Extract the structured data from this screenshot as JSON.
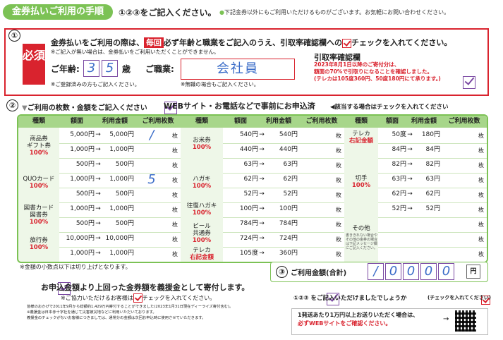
{
  "header": {
    "title": "金券払いご利用の手順",
    "instruction": "①②③をご記入ください。",
    "note": "下記金券以外にもご利用いただけるものがございます。お気軽にお問い合わせください。"
  },
  "section1": {
    "number": "①",
    "must": "必須",
    "line1_a": "金券払いをご利用の際は、",
    "line1_every": "毎回",
    "line1_b": "必ず年齢と職業をご記入のうえ、引取率確認欄への",
    "line1_c": "チェックを入れてください。",
    "line2": "※ご記入が無い場合は、金券払いをご利用いただくことができません。",
    "age_label": "ご年齢:",
    "age_digits": [
      "3",
      "5"
    ],
    "age_unit": "歳",
    "job_label": "ご職業:",
    "job_value": "会社員",
    "note_registered": "※ご登録済みの方もご記入ください。",
    "note_unemployed": "※無職の場合もご記入ください。",
    "rate_title": "引取率確認欄",
    "rate_1": "2023年8月1日以降のご寄付分は、",
    "rate_2": "額面の70%で引取りになることを確認しました。",
    "rate_3": "(テレカは105度360円、50度180円にて承ります。)"
  },
  "section2": {
    "number": "②",
    "title": "ご利用の枚数・金額をご記入ください",
    "web_label": "WEBサイト・お電話などで事前にお申込済",
    "web_note": "◀該当する場合はチェックを入れてください",
    "headers": {
      "kind": "種類",
      "face": "額面",
      "amount": "利用金額",
      "count": "ご利用枚数"
    },
    "unit": "枚",
    "col1": {
      "rows": [
        {
          "face": "5,000円",
          "amount": "5,000円",
          "count": "/"
        },
        {
          "face": "1,000円",
          "amount": "1,000円",
          "count": ""
        },
        {
          "face": "500円",
          "amount": "500円",
          "count": ""
        },
        {
          "face": "1,000円",
          "amount": "1,000円",
          "count": "5"
        },
        {
          "face": "500円",
          "amount": "500円",
          "count": ""
        },
        {
          "face": "1,000円",
          "amount": "1,000円",
          "count": ""
        },
        {
          "face": "500円",
          "amount": "500円",
          "count": ""
        },
        {
          "face": "10,000円",
          "amount": "10,000円",
          "count": ""
        },
        {
          "face": "1,000円",
          "amount": "1,000円",
          "count": ""
        }
      ],
      "categories": [
        {
          "name": "商品券\nギフト券",
          "pct": "100%"
        },
        {
          "name": "QUOカード",
          "pct": "100%"
        },
        {
          "name": "図書カード\n図書券",
          "pct": "100%"
        },
        {
          "name": "旅行券",
          "pct": "100%"
        }
      ]
    },
    "col2": {
      "rows": [
        {
          "face": "540円",
          "amount": "540円"
        },
        {
          "face": "440円",
          "amount": "440円"
        },
        {
          "face": "63円",
          "amount": "63円"
        },
        {
          "face": "62円",
          "amount": "62円"
        },
        {
          "face": "52円",
          "amount": "52円"
        },
        {
          "face": "100円",
          "amount": "100円"
        },
        {
          "face": "784円",
          "amount": "784円"
        },
        {
          "face": "724円",
          "amount": "724円"
        },
        {
          "face": "105度",
          "amount": "360円"
        }
      ],
      "categories": [
        {
          "name": "お米券",
          "pct": "100%"
        },
        {
          "name": "ハガキ",
          "pct": "100%"
        },
        {
          "name": "往復ハガキ",
          "pct": "100%"
        },
        {
          "name": "ビール\n共通券",
          "pct": "100%"
        },
        {
          "name": "テレカ",
          "pct": "右記金額"
        }
      ]
    },
    "col3": {
      "rows": [
        {
          "face": "50度",
          "amount": "180円"
        },
        {
          "face": "84円",
          "amount": "84円"
        },
        {
          "face": "82円",
          "amount": "82円"
        },
        {
          "face": "63円",
          "amount": "63円"
        },
        {
          "face": "62円",
          "amount": "62円"
        },
        {
          "face": "52円",
          "amount": "52円"
        }
      ],
      "categories": [
        {
          "name": "テレカ",
          "pct": "右記金額"
        },
        {
          "name": "切手",
          "pct": "100%"
        },
        {
          "name": "その他",
          "pct": ""
        }
      ],
      "other_note": "書ききれない場合やその他の金券の場合は下記メッセージ欄にご記入ください。"
    }
  },
  "footnote": "※金額の小数点以下は切り上げとなります。",
  "section3": {
    "number": "③",
    "label": "ご利用金額(合計)",
    "digits": [
      "/",
      "0",
      "0",
      "0",
      "0"
    ],
    "unit": "円"
  },
  "donation": {
    "title": "お申込金額より上回った金券額を義援金として寄付します。",
    "sub_a": "※ご協力いただけるお客様は",
    "sub_b": "チェックを入れてください。",
    "fine1": "皆様のおかげで2011年9月から総額約1,429万円寄付することができました(2023年1月31日現在ディーライズ寄付含む)。",
    "fine2": "※義援金は日本赤十字社を通じて災害被災地などに利用いただいております。",
    "fine3": "義援金のチェックがないお客様につきましては、通常分の金額は次回お申込時に使用させていただきます。"
  },
  "confirm": {
    "text": "①②③ をご記入いただけましたでしょうか",
    "note": "(チェックを入れてください)"
  },
  "shipping": {
    "line1": "1発送あたり1万円以上お送りいただく場合は、",
    "line2": "必ずWEBサイトをご確認ください。"
  }
}
